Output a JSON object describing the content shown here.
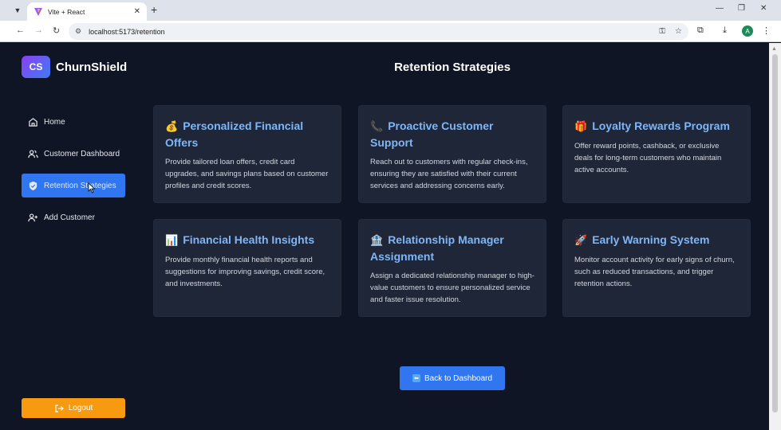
{
  "browser": {
    "tab_title": "Vite + React",
    "url": "localhost:5173/retention",
    "profile_initial": "A"
  },
  "brand": {
    "logo_text": "CS",
    "name": "ChurnShield"
  },
  "sidebar": {
    "items": [
      {
        "label": "Home",
        "icon": "home-icon",
        "active": false
      },
      {
        "label": "Customer Dashboard",
        "icon": "users-icon",
        "active": false
      },
      {
        "label": "Retention Strategies",
        "icon": "shield-icon",
        "active": true
      },
      {
        "label": "Add Customer",
        "icon": "user-plus-icon",
        "active": false
      }
    ],
    "logout_label": "Logout"
  },
  "page": {
    "title": "Retention Strategies",
    "back_label": "Back to Dashboard"
  },
  "strategies": [
    {
      "emoji": "💰",
      "title": "Personalized Financial Offers",
      "desc": "Provide tailored loan offers, credit card upgrades, and savings plans based on customer profiles and credit scores."
    },
    {
      "emoji": "📞",
      "title": "Proactive Customer Support",
      "desc": "Reach out to customers with regular check-ins, ensuring they are satisfied with their current services and addressing concerns early."
    },
    {
      "emoji": "🎁",
      "title": "Loyalty Rewards Program",
      "desc": "Offer reward points, cashback, or exclusive deals for long-term customers who maintain active accounts."
    },
    {
      "emoji": "📊",
      "title": "Financial Health Insights",
      "desc": "Provide monthly financial health reports and suggestions for improving savings, credit score, and investments."
    },
    {
      "emoji": "🏦",
      "title": "Relationship Manager Assignment",
      "desc": "Assign a dedicated relationship manager to high-value customers to ensure personalized service and faster issue resolution."
    },
    {
      "emoji": "🚀",
      "title": "Early Warning System",
      "desc": "Monitor account activity for early signs of churn, such as reduced transactions, and trigger retention actions."
    }
  ],
  "colors": {
    "background": "#0f1524",
    "card": "#1e2637",
    "accent": "#2f76f0",
    "card_title": "#7fb6f7",
    "logout": "#f79a10"
  }
}
